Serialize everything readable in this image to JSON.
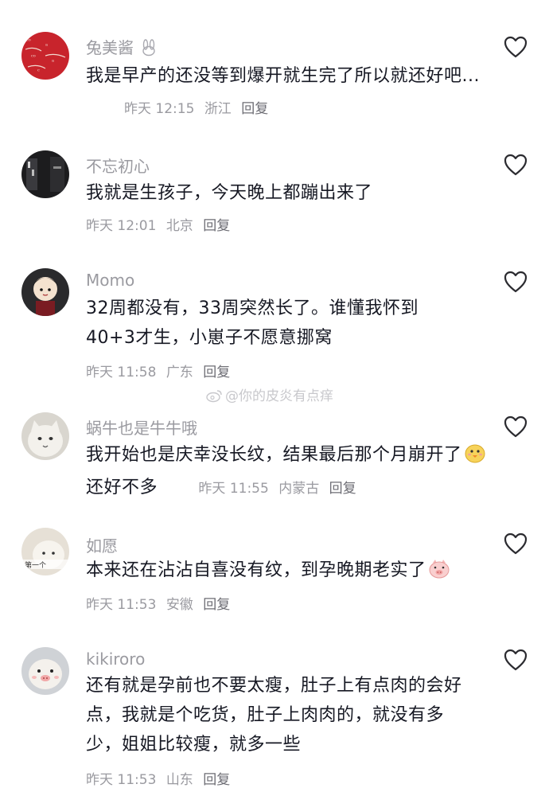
{
  "comments": [
    {
      "username": "兔美酱",
      "text": "我是早产的还没等到爆开就生完了所以就还好吧...",
      "time": "昨天 12:15",
      "location": "浙江",
      "reply": "回复"
    },
    {
      "username": "不忘初心",
      "text": "我就是生孩子，今天晚上都蹦出来了",
      "time": "昨天 12:01",
      "location": "北京",
      "reply": "回复"
    },
    {
      "username": "Momo",
      "text": "32周都没有，33周突然长了。谁懂我怀到40+3才生，小崽子不愿意挪窝",
      "time": "昨天 11:58",
      "location": "广东",
      "reply": "回复"
    },
    {
      "username": "蜗牛也是牛牛哦",
      "text_a": "我开始也是庆幸没长纹，结果最后那个月崩开了",
      "text_b": "还好不多",
      "time": "昨天 11:55",
      "location": "内蒙古",
      "reply": "回复"
    },
    {
      "username": "如愿",
      "text": "本来还在沾沾自喜没有纹，到孕晚期老实了",
      "time": "昨天 11:53",
      "location": "安徽",
      "reply": "回复"
    },
    {
      "username": "kikiroro",
      "text": "还有就是孕前也不要太瘦，肚子上有点肉的会好点，我就是个吃货，肚子上肉肉的，就没有多少，姐姐比较瘦，就多一些",
      "time": "昨天 11:53",
      "location": "山东",
      "reply": "回复"
    }
  ],
  "watermark": "@你的皮炎有点痒",
  "icons": {
    "like": "heart-outline-icon",
    "emoji_username": "rabbit-emoji",
    "emoji_chick": "chick-emoji",
    "emoji_pig": "pig-emoji"
  },
  "colors": {
    "text": "#161823",
    "secondary": "#9a9aa0",
    "reply": "#6d6d74"
  }
}
